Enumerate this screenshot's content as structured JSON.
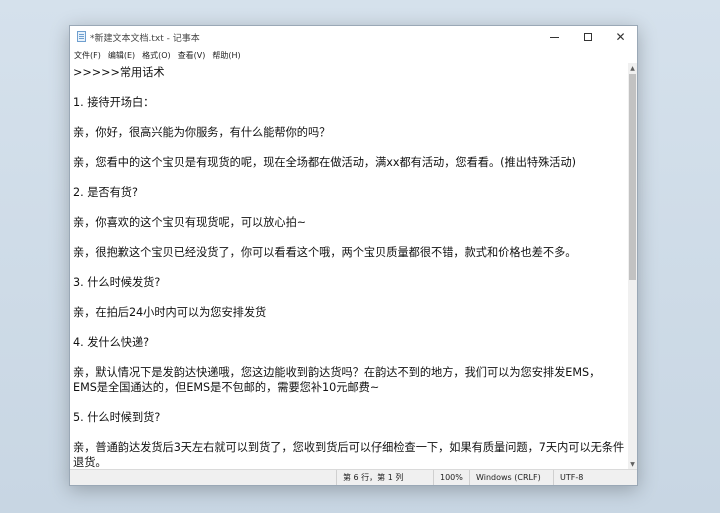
{
  "window": {
    "title": "*新建文本文档.txt - 记事本",
    "app_icon": "notepad-icon",
    "controls": {
      "minimize_icon": "minimize-icon",
      "maximize_icon": "maximize-icon",
      "close_icon": "close-icon"
    }
  },
  "menu": {
    "items": [
      {
        "label": "文件(F)"
      },
      {
        "label": "编辑(E)"
      },
      {
        "label": "格式(O)"
      },
      {
        "label": "查看(V)"
      },
      {
        "label": "帮助(H)"
      }
    ]
  },
  "editor": {
    "lines": [
      ">>>>>常用话术",
      "",
      "1. 接待开场白：",
      "",
      "亲，你好，很高兴能为你服务，有什么能帮你的吗？",
      "",
      "亲，您看中的这个宝贝是有现货的呢，现在全场都在做活动，满xx都有活动，您看看。(推出特殊活动)",
      "",
      "2. 是否有货?",
      "",
      "亲，你喜欢的这个宝贝有现货呢，可以放心拍~",
      "",
      "亲，很抱歉这个宝贝已经没货了，你可以看看这个哦，两个宝贝质量都很不错，款式和价格也差不多。",
      "",
      "3. 什么时候发货?",
      "",
      "亲，在拍后24小时内可以为您安排发货",
      "",
      "4. 发什么快递?",
      "",
      "亲，默认情况下是发韵达快递哦，您这边能收到韵达货吗？在韵达不到的地方，我们可以为您安排发EMS，",
      "EMS是全国通达的，但EMS是不包邮的，需要您补10元邮费~",
      "",
      "5. 什么时候到货?",
      "",
      "亲，普通韵达发货后3天左右就可以到货了，您收到货后可以仔细检查一下，如果有质量问题，7天内可以无条件",
      "退货。"
    ]
  },
  "status": {
    "position": "第 6 行，第 1 列",
    "zoom": "100%",
    "line_ending": "Windows (CRLF)",
    "encoding": "UTF-8"
  }
}
